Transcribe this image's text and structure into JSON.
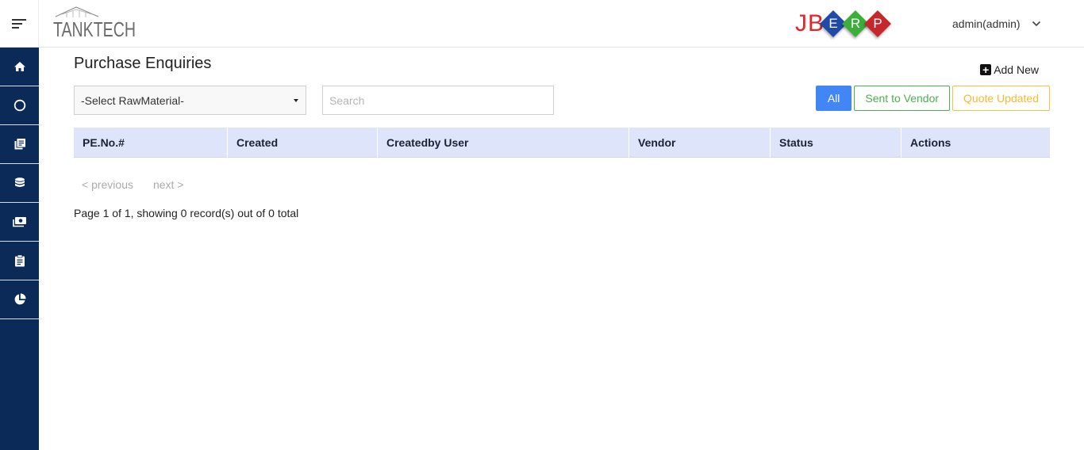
{
  "header": {
    "brand": "TANKTECH",
    "erp_logo": {
      "jb": "JB",
      "letters": [
        "E",
        "R",
        "P"
      ],
      "colors": [
        "#1f4aa8",
        "#3cae3a",
        "#c6272d"
      ]
    },
    "user": "admin(admin)"
  },
  "sidebar": {
    "items": [
      {
        "icon": "home-icon"
      },
      {
        "icon": "circle-icon"
      },
      {
        "icon": "books-icon"
      },
      {
        "icon": "database-icon"
      },
      {
        "icon": "money-icon"
      },
      {
        "icon": "clipboard-icon"
      },
      {
        "icon": "pie-chart-icon"
      }
    ],
    "color": "#0b2a57"
  },
  "page": {
    "title": "Purchase Enquiries",
    "add_new": "Add New",
    "select_value": "-Select RawMaterial-",
    "search_placeholder": "Search",
    "filters": {
      "all": "All",
      "sent": "Sent to Vendor",
      "quote": "Quote Updated"
    },
    "table": {
      "columns": [
        "PE.No.#",
        "Created",
        "Createdby User",
        "Vendor",
        "Status",
        "Actions"
      ],
      "rows": []
    },
    "pager": {
      "previous": "< previous",
      "next": "next >"
    },
    "page_info": "Page 1 of 1, showing 0 record(s) out of 0 total"
  }
}
